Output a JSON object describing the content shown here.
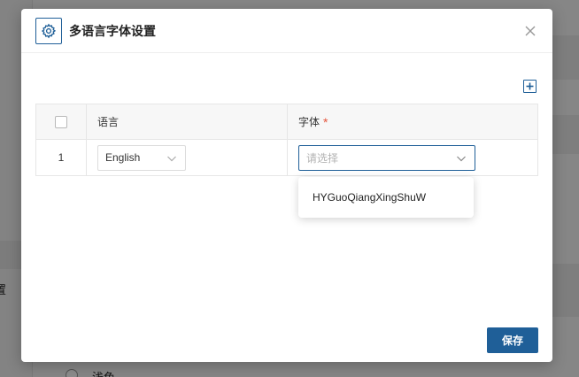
{
  "background": {
    "left_text": "置",
    "bottom_text": "浅色"
  },
  "dialog": {
    "title": "多语言字体设置",
    "icon": "gear-icon",
    "close_icon": "close-icon",
    "add_icon": "plus-square-icon",
    "accent_color": "#1f5f98"
  },
  "table": {
    "headers": {
      "language": "语言",
      "font": "字体",
      "required_mark": "*"
    },
    "rows": [
      {
        "index": "1",
        "language_value": "English",
        "font_placeholder": "请选择"
      }
    ]
  },
  "dropdown": {
    "options": [
      "HYGuoQiangXingShuW"
    ]
  },
  "footer": {
    "save_label": "保存"
  }
}
